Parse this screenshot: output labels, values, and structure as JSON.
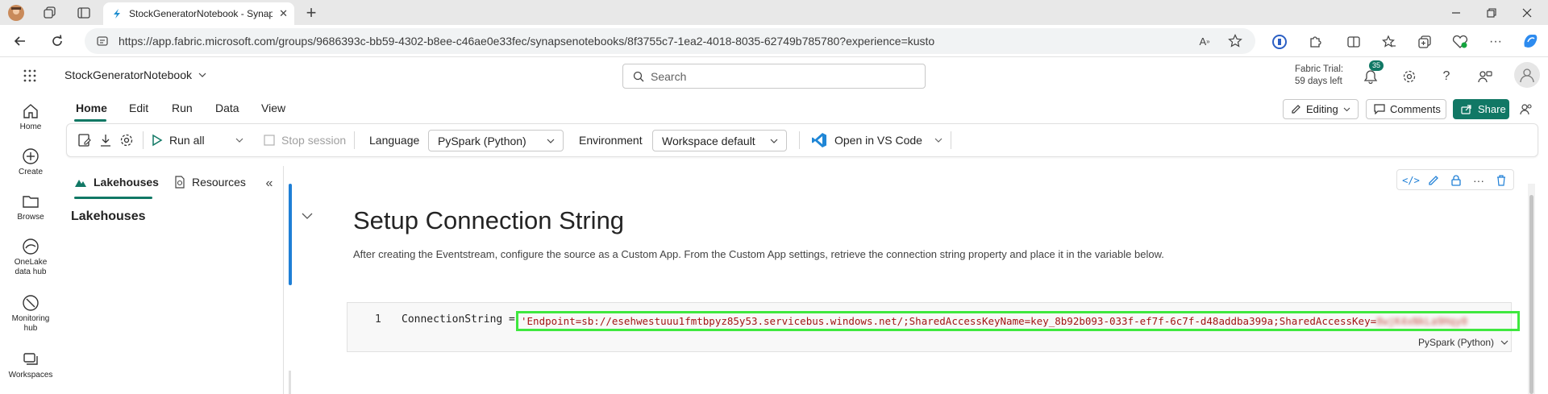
{
  "browser": {
    "tab_title": "StockGeneratorNotebook - Synapse",
    "url": "https://app.fabric.microsoft.com/groups/9686393c-bb59-4302-b8ee-c46ae0e33fec/synapsenotebooks/8f3755c7-1ea2-4018-8035-62749b785780?experience=kusto",
    "new_tab_glyph": "+",
    "window_controls": [
      "minimize-icon",
      "restore-icon",
      "close-icon"
    ]
  },
  "app": {
    "notebook_name": "StockGeneratorNotebook",
    "search_placeholder": "Search",
    "trial_line1": "Fabric Trial:",
    "trial_line2": "59 days left",
    "notification_count": "35",
    "accent_color": "#117865"
  },
  "left_nav": {
    "items": [
      {
        "label": "Home",
        "icon": "home-icon"
      },
      {
        "label": "Create",
        "icon": "create-icon"
      },
      {
        "label": "Browse",
        "icon": "folder-icon"
      },
      {
        "label": "OneLake data hub",
        "icon": "onelake-icon"
      },
      {
        "label": "Monitoring hub",
        "icon": "monitoring-icon"
      },
      {
        "label": "Workspaces",
        "icon": "workspaces-icon"
      }
    ]
  },
  "ribbon": {
    "tabs": [
      "Home",
      "Edit",
      "Run",
      "Data",
      "View"
    ],
    "active_tab": "Home",
    "editing_label": "Editing",
    "comments_label": "Comments",
    "share_label": "Share"
  },
  "toolbar": {
    "run_all": "Run all",
    "stop_session": "Stop session",
    "language_label": "Language",
    "language_value": "PySpark (Python)",
    "environment_label": "Environment",
    "environment_value": "Workspace default",
    "vscode_label": "Open in VS Code"
  },
  "side_panel": {
    "tab_lakehouses": "Lakehouses",
    "tab_resources": "Resources",
    "heading": "Lakehouses"
  },
  "cells": {
    "markdown_title": "Setup Connection String",
    "markdown_body": "After creating the Eventstream, configure the source as a Custom App. From the Custom App settings, retrieve the connection string property and place it in the variable below.",
    "code_line_number": "1",
    "code_var": "ConnectionString = ",
    "code_string": "'Endpoint=sb://esehwestuuu1fmtbpyz85y53.servicebus.windows.net/;SharedAccessKeyName=key_8b92b093-033f-ef7f-6c7f-d48addba399a;SharedAccessKey=",
    "code_secret": "8wjK4xNkLa9Hqy0",
    "code_language": "PySpark (Python)"
  }
}
